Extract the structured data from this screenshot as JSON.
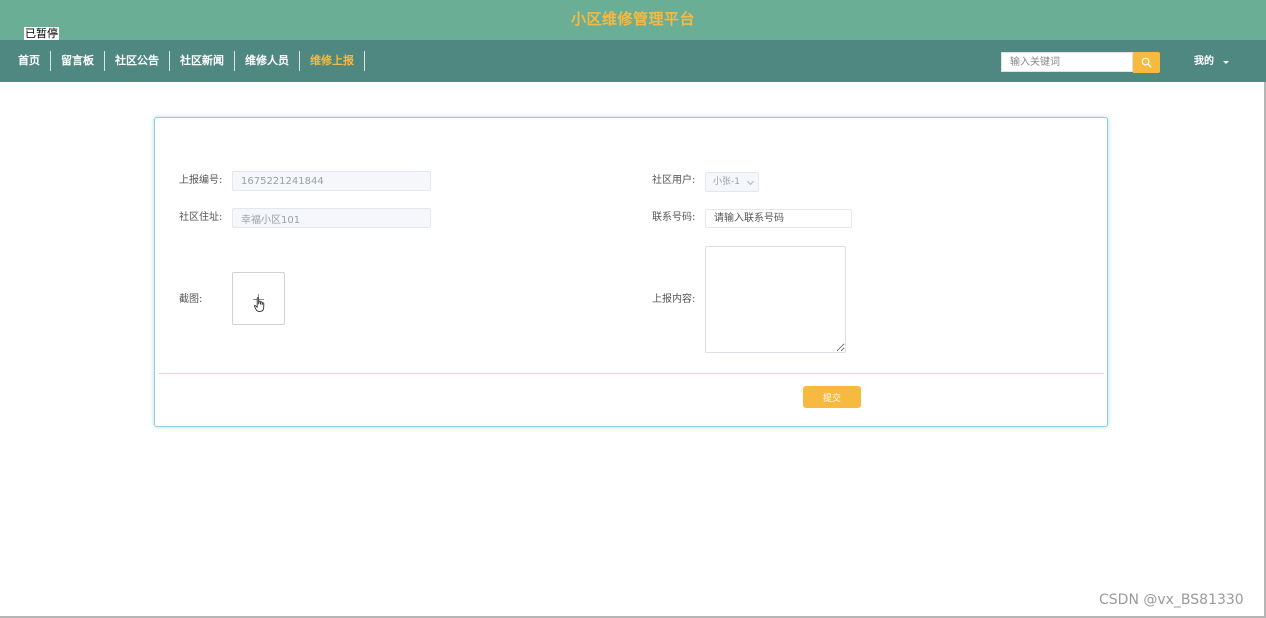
{
  "header": {
    "site_title": "小区维修管理平台",
    "paused_label": "已暂停"
  },
  "nav": {
    "items": [
      {
        "label": "首页"
      },
      {
        "label": "留言板"
      },
      {
        "label": "社区公告"
      },
      {
        "label": "社区新闻"
      },
      {
        "label": "维修人员"
      },
      {
        "label": "维修上报",
        "active": true
      }
    ]
  },
  "search": {
    "placeholder": "输入关键词",
    "icon": "search-icon"
  },
  "user_menu": {
    "label": "我的",
    "icon": "caret-down-icon"
  },
  "form": {
    "report_no": {
      "label": "上报编号:",
      "value": "1675221241844"
    },
    "community_user": {
      "label": "社区用户:",
      "selected": "小张-1"
    },
    "address": {
      "label": "社区住址:",
      "value": "幸福小区101"
    },
    "phone": {
      "label": "联系号码:",
      "placeholder": "请输入联系号码"
    },
    "screenshot": {
      "label": "截图:",
      "icon": "plus-icon"
    },
    "content": {
      "label": "上报内容:",
      "value": ""
    },
    "submit_label": "提交"
  },
  "watermark": "CSDN @vx_BS81330",
  "colors": {
    "header_bg": "#6aae96",
    "nav_bg": "#4f8781",
    "accent": "#f7b940",
    "card_border": "#8fcfe2"
  }
}
